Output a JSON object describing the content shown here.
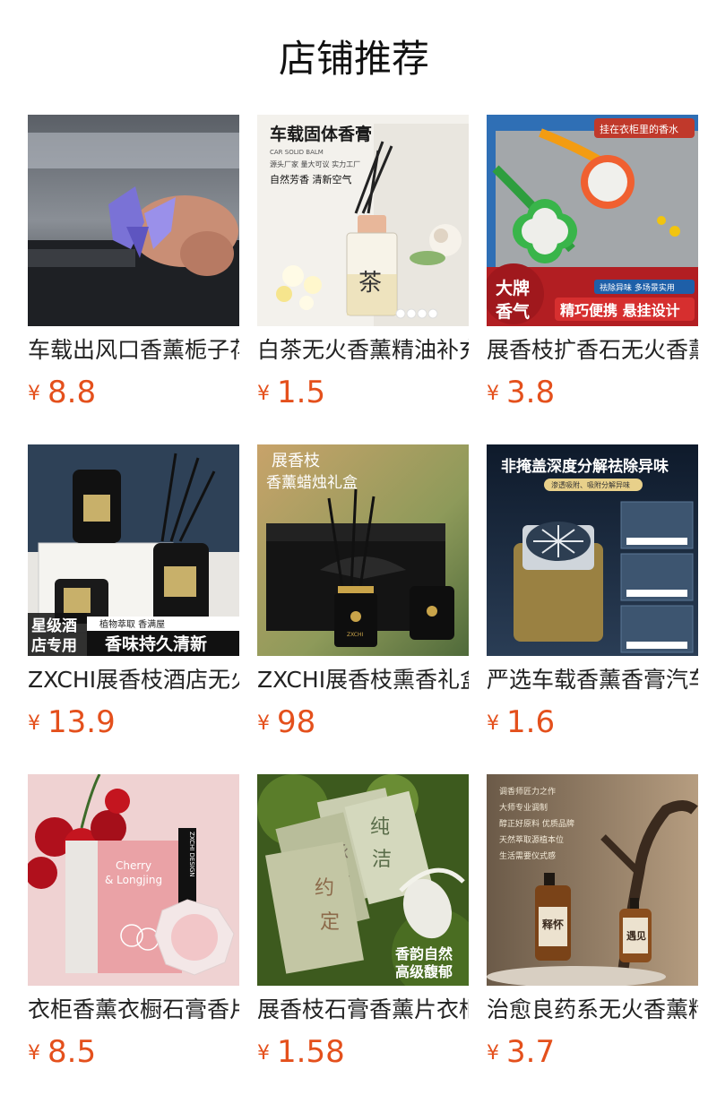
{
  "header": {
    "title": "店铺推荐"
  },
  "currency_symbol": "¥",
  "products": [
    {
      "name": "车载出风口香薰栀子花",
      "price": "8.8",
      "image_text": []
    },
    {
      "name": "白茶无火香薰精油补充",
      "price": "1.5",
      "image_text": [
        "车载固体香膏",
        "CAR SOLID BALM",
        "源头厂家 量大可议 实力工厂",
        "自然芳香  清新空气",
        "茶"
      ]
    },
    {
      "name": "展香枝扩香石无火香薰",
      "price": "3.8",
      "image_text": [
        "挂在衣柜里的香水",
        "大牌",
        "香气",
        "祛除异味  多场景实用",
        "精巧便携 悬挂设计"
      ]
    },
    {
      "name": "ZXCHI展香枝酒店无火香薰",
      "price": "13.9",
      "image_text": [
        "星级酒",
        "店专用",
        "植物萃取 香满屋",
        "香味持久清新"
      ]
    },
    {
      "name": "ZXCHI展香枝熏香礼盒",
      "price": "98",
      "image_text": [
        "展香枝",
        "香薰蜡烛礼盒",
        "ZXCHI"
      ]
    },
    {
      "name": "严选车载香薰香膏汽车",
      "price": "1.6",
      "image_text": [
        "非掩盖深度分解祛除异味",
        "渗透吸附、吸附分解异味"
      ]
    },
    {
      "name": "衣柜香薰衣橱石膏香片",
      "price": "8.5",
      "image_text": [
        "Cherry",
        "& Longjing",
        "ZXCHI DESIGN"
      ]
    },
    {
      "name": "展香枝石膏香薰片衣柜",
      "price": "1.58",
      "image_text": [
        "纯",
        "洁",
        "承",
        "诺",
        "约",
        "定",
        "香韵自然",
        "高级馥郁"
      ]
    },
    {
      "name": "治愈良药系无火香薰精油",
      "price": "3.7",
      "image_text": [
        "调香师匠力之作",
        "大师专业调制",
        "醇正好原料 优质品牌",
        "天然萃取源植本位",
        "生活需要仪式感",
        "释怀",
        "遇见"
      ]
    }
  ],
  "theme": {
    "price_color": "#e4501c",
    "title_color": "#111111"
  }
}
